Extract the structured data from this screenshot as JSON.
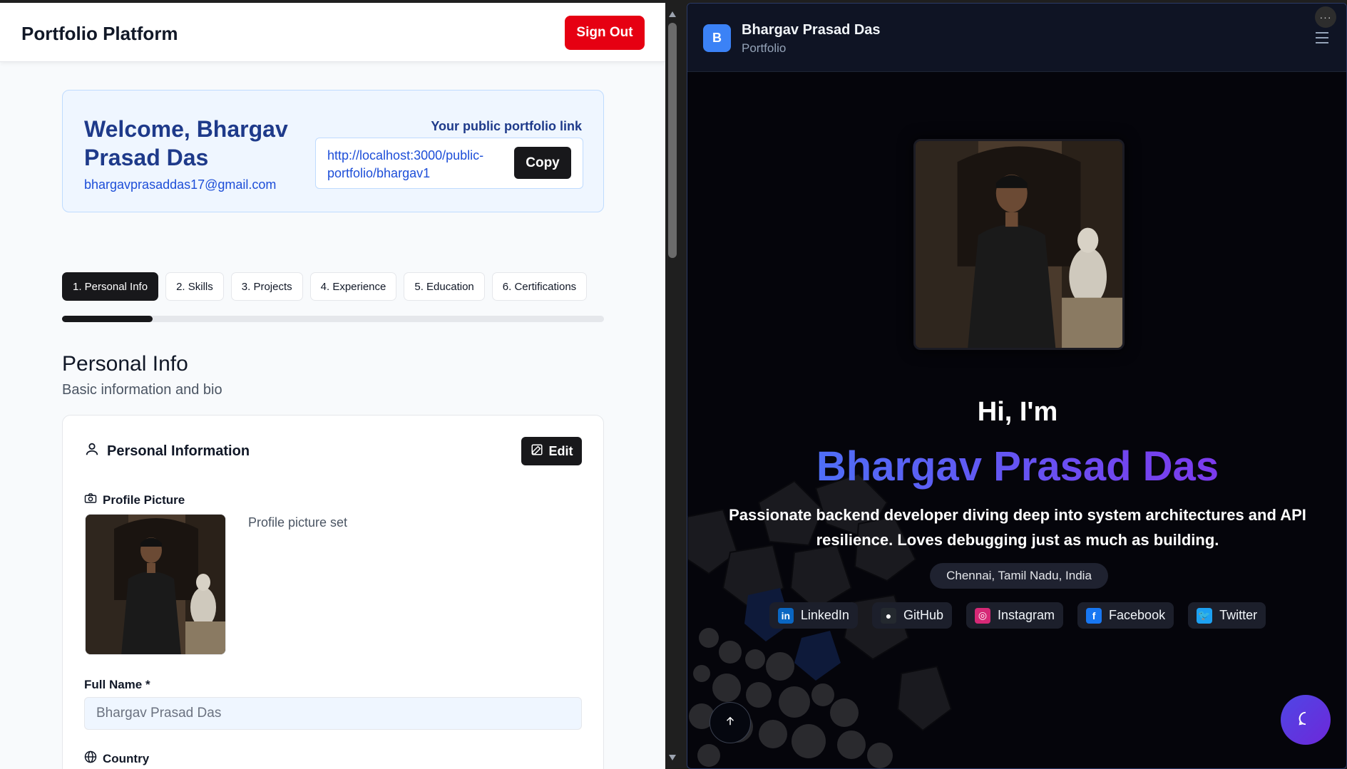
{
  "editor": {
    "brand": "Portfolio Platform",
    "sign_out_label": "Sign Out",
    "welcome": {
      "title": "Welcome, Bhargav Prasad Das",
      "email": "bhargavprasaddas17@gmail.com",
      "link_label": "Your public portfolio link",
      "link_url": "http://localhost:3000/public-portfolio/bhargav1",
      "copy_label": "Copy"
    },
    "steps": [
      {
        "label": "1. Personal Info",
        "active": true
      },
      {
        "label": "2. Skills",
        "active": false
      },
      {
        "label": "3. Projects",
        "active": false
      },
      {
        "label": "4. Experience",
        "active": false
      },
      {
        "label": "5. Education",
        "active": false
      },
      {
        "label": "6. Certifications",
        "active": false
      }
    ],
    "progress_percent": 16.7,
    "section": {
      "title": "Personal Info",
      "subtitle": "Basic information and bio"
    },
    "card": {
      "title": "Personal Information",
      "edit_label": "Edit",
      "profile_picture_label": "Profile Picture",
      "profile_picture_status": "Profile picture set",
      "full_name_label": "Full Name *",
      "full_name_value": "Bhargav Prasad Das",
      "country_label": "Country"
    }
  },
  "preview": {
    "header": {
      "avatar_letter": "B",
      "name": "Bhargav Prasad Das",
      "subtitle": "Portfolio",
      "more_label": "···"
    },
    "hero": {
      "greeting": "Hi, I'm",
      "name": "Bhargav Prasad Das",
      "bio": "Passionate backend developer diving deep into system architectures and API resilience. Loves debugging just as much as building.",
      "location": "Chennai, Tamil Nadu, India"
    },
    "socials": [
      {
        "label": "LinkedIn",
        "icon": "linkedin-icon",
        "color": "#0a66c2",
        "glyph": "in"
      },
      {
        "label": "GitHub",
        "icon": "github-icon",
        "color": "#24292f",
        "glyph": "●"
      },
      {
        "label": "Instagram",
        "icon": "instagram-icon",
        "color": "#d62976",
        "glyph": "◎"
      },
      {
        "label": "Facebook",
        "icon": "facebook-icon",
        "color": "#1877f2",
        "glyph": "f"
      },
      {
        "label": "Twitter",
        "icon": "twitter-icon",
        "color": "#1da1f2",
        "glyph": "🐦"
      }
    ]
  }
}
